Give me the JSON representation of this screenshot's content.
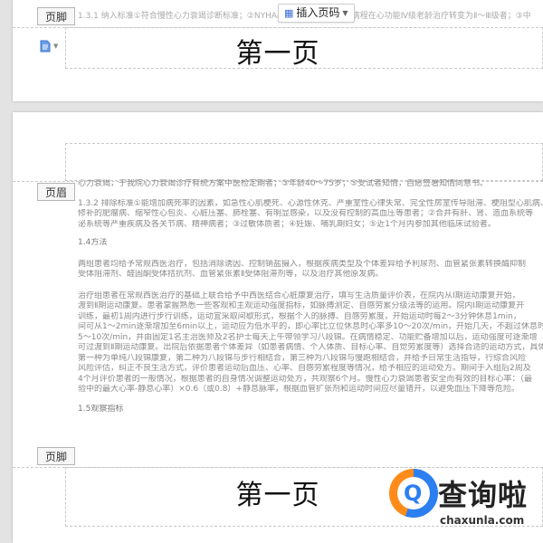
{
  "top_page": {
    "footer_tag": "页脚",
    "faint_line": "1.3.1 纳入标准①符合慢性心力衰竭诊断标准；②NYHA心功能分级Ⅱ～Ⅲ级，病程在心功能Ⅳ级老龄治疗转变为Ⅱ～Ⅲ级者；③中医",
    "insert_page_number": "插入页码",
    "footer_text": "第一页"
  },
  "bottom_page": {
    "header_tag": "页眉",
    "footer_tag": "页脚",
    "footer_text": "第一页",
    "paragraphs": [
      {
        "text": "心力衰竭，于我院心力衰竭诊疗有统方案中医检定期者；③年龄40～75岁；⑤受试者知情，自愿签署知情同意书。",
        "cls": "tight"
      },
      {
        "text": "1.3.2 排除标准①能增加病死率的因素，如急性心肌梗死、心源性休克、严重室性心律失常、完全性房室传导阻滞、梗阻型心肌病、",
        "cls": "tight"
      },
      {
        "text": "修补的肥瘤病、缩窄性心包炎、心脏压塞、肺栓塞、有明显感染，以及没有控制的高血压等患者；②合并有肝、肾、造血系统等",
        "cls": "tight"
      },
      {
        "text": "泌系统等严重疾病及各关节病、精神病者；③过敏体质者；④妊娠、哺乳期妇女；⑤近1个月内参加其他临床试验者。",
        "cls": ""
      },
      {
        "text": "1.4方法",
        "cls": "heading"
      },
      {
        "text": "两组患者均给予常规西医治疗，包括消除诱因、控制钠盐摄入，根据疾病类型及个体差异给予利尿剂、血管紧张素转换酶抑制",
        "cls": "tight"
      },
      {
        "text": "受体阻滞剂、醛固酮受体拮抗剂、血管紧张素Ⅱ受体阻滞剂等，以及治疗其他原发病。",
        "cls": ""
      },
      {
        "text": "治疗组患者在常规西医治疗的基础上联合给予中西医结合心脏康复治疗，填写生活质量评价表，在院内从Ⅰ期运动康复开始，",
        "cls": "tight"
      },
      {
        "text": "渡到Ⅱ期运动康复。患者掌握熟悉一些客观和主观运动强度指标，如脉搏测定、自感劳累分级法等的运用。院内Ⅰ期运动康复开",
        "cls": "tight"
      },
      {
        "text": "训练，最初1周内进行步行训练，运动宜采取间歇形式，根据个人的脉搏、自感劳累度，开始运动时每2～3分钟休息1min，",
        "cls": "tight"
      },
      {
        "text": "间可从1～2min逐渐增加至6min以上，运动应为低水平的，即心率比立位休息时心率多10～20次/min，开始几天，不超过休息时",
        "cls": "tight"
      },
      {
        "text": "5～10次/min，并由固定1名主治医师及2名护士每天上午带领学习八段锦。在病情稳定、功能贮备增加以后，运动强度可逐渐增",
        "cls": "tight"
      },
      {
        "text": "可过渡到Ⅱ期运动康复。出院后依据患者个体差异（如患者病情、个人体质、目标心率、自觉劳累度等）选择合适的运动方式，具体",
        "cls": "tight"
      },
      {
        "text": "第一种为单纯八段锦康复，第二种为八段锦与步行相结合，第三种为八段锦与慢跑相结合，并给予日常生活指导，行综合风险",
        "cls": "tight"
      },
      {
        "text": "风险评估，纠正不良生活方式，评价患者运动后血压、心率、自感劳累程度等情况，给予相应的运动处方。期间于入组后2周及",
        "cls": "tight"
      },
      {
        "text": "4个月评价患者的一般情况，根据患者的自身情况调整运动处方，共观察6个月。慢性心力衰竭患者安全而有效的目标心率：（最",
        "cls": "tight"
      },
      {
        "text": "验中的最大心率-静息心率）×0.6（或0.8）+静息脉率，根据血管扩张剂和运动时间应尽量错开，以避免血压下降等危险。",
        "cls": ""
      },
      {
        "text": "1.5观察指标",
        "cls": "heading"
      }
    ]
  },
  "logo": {
    "glyph": "Q",
    "name": "查询啦",
    "url": "chaxunla.com"
  }
}
